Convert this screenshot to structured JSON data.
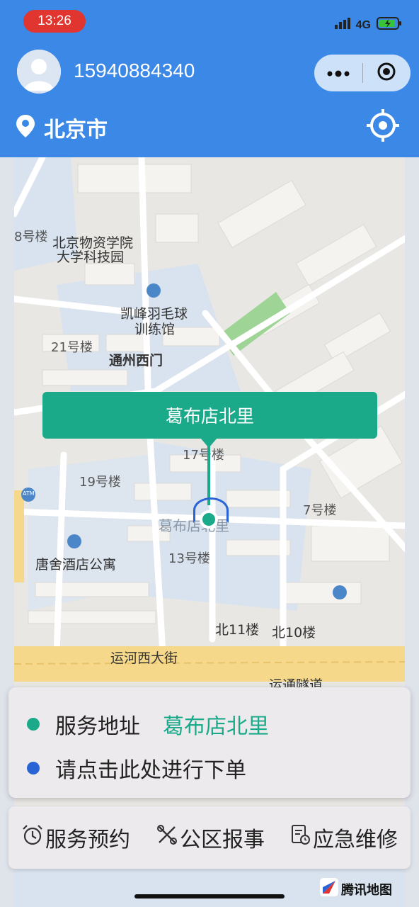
{
  "status": {
    "time": "13:26",
    "network": "4G"
  },
  "user": {
    "phone": "15940884340"
  },
  "location": {
    "city": "北京市"
  },
  "map": {
    "callout": "葛布店北里",
    "labels": [
      "北京物资学院",
      "大学科技园",
      "凯峰羽毛球",
      "训练馆",
      "21号楼",
      "通州西门",
      "17号楼",
      "19号楼",
      "7号楼",
      "13号楼",
      "唐舍酒店公寓",
      "北11楼",
      "北10楼",
      "运河西大街",
      "运通隧道",
      "8号楼",
      "葛布店北里",
      "ATM"
    ],
    "provider": "腾讯地图"
  },
  "service_card": {
    "service_label": "服务地址",
    "service_address": "葛布店北里",
    "order_prompt": "请点击此处进行下单"
  },
  "bottom_nav": {
    "items": [
      {
        "label": "服务预约",
        "icon": "alarm-clock-icon"
      },
      {
        "label": "公区报事",
        "icon": "tools-icon"
      },
      {
        "label": "应急维修",
        "icon": "document-clock-icon"
      }
    ]
  },
  "colors": {
    "header": "#3b88e6",
    "accent": "#1aaa8a",
    "order_dot": "#2a64d4"
  }
}
